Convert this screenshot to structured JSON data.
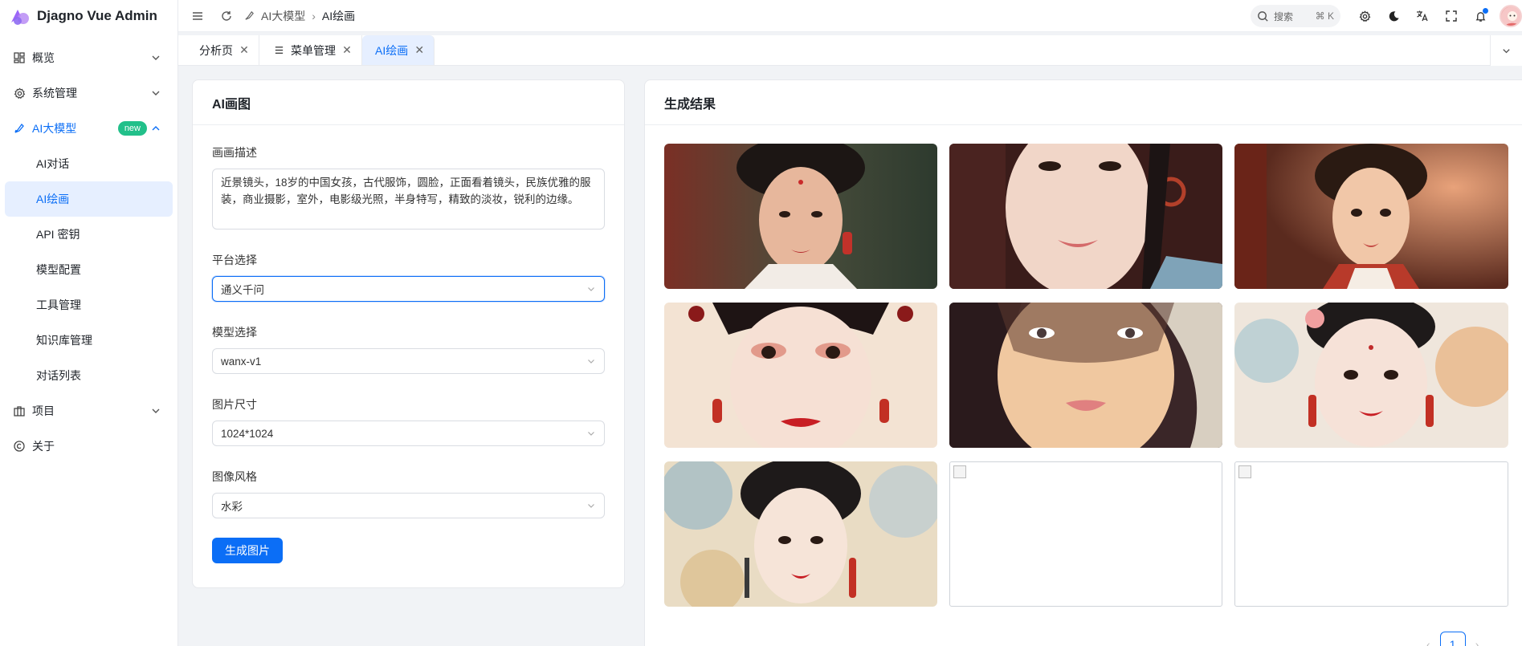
{
  "app": {
    "title": "Djagno Vue Admin"
  },
  "sidebar": {
    "items": [
      {
        "label": "概览",
        "icon": "dashboard-icon",
        "expandable": true
      },
      {
        "label": "系统管理",
        "icon": "gear-icon",
        "expandable": true
      },
      {
        "label": "AI大模型",
        "icon": "ai-brush-icon",
        "badge": "new",
        "expanded": true,
        "children": [
          {
            "label": "AI对话"
          },
          {
            "label": "AI绘画",
            "active": true
          },
          {
            "label": "API 密钥"
          },
          {
            "label": "模型配置"
          },
          {
            "label": "工具管理"
          },
          {
            "label": "知识库管理"
          },
          {
            "label": "对话列表"
          }
        ]
      },
      {
        "label": "项目",
        "icon": "project-icon",
        "expandable": true
      },
      {
        "label": "关于",
        "icon": "copyright-icon",
        "expandable": false
      }
    ]
  },
  "header": {
    "breadcrumb": {
      "parent": "AI大模型",
      "current": "AI绘画"
    },
    "search": {
      "placeholder": "搜索",
      "shortcut": "⌘ K"
    }
  },
  "tabs": [
    {
      "label": "分析页",
      "active": false,
      "icon": ""
    },
    {
      "label": "菜单管理",
      "active": false,
      "icon": "list-icon"
    },
    {
      "label": "AI绘画",
      "active": true,
      "icon": ""
    }
  ],
  "left_panel": {
    "title": "AI画图",
    "prompt_label": "画画描述",
    "prompt_value": "近景镜头，18岁的中国女孩，古代服饰，圆脸，正面看着镜头，民族优雅的服装，商业摄影，室外，电影级光照，半身特写，精致的淡妆，锐利的边缘。",
    "platform_label": "平台选择",
    "platform_value": "通义千问",
    "model_label": "模型选择",
    "model_value": "wanx-v1",
    "size_label": "图片尺寸",
    "size_value": "1024*1024",
    "style_label": "图像风格",
    "style_value": "水彩",
    "generate_button": "生成图片"
  },
  "right_panel": {
    "title": "生成结果",
    "images": [
      {
        "name": "result-image-1",
        "broken": false
      },
      {
        "name": "result-image-2",
        "broken": false
      },
      {
        "name": "result-image-3",
        "broken": false
      },
      {
        "name": "result-image-4",
        "broken": false
      },
      {
        "name": "result-image-5",
        "broken": false
      },
      {
        "name": "result-image-6",
        "broken": false
      },
      {
        "name": "result-image-7",
        "broken": false
      },
      {
        "name": "result-image-8",
        "broken": true
      },
      {
        "name": "result-image-9",
        "broken": true
      }
    ],
    "pagination": {
      "current": "1"
    }
  },
  "colors": {
    "accent": "#0b6ef6",
    "badge": "#22c08a"
  }
}
